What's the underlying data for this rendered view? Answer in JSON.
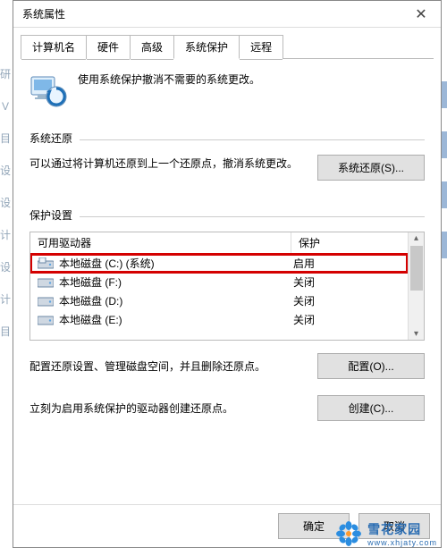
{
  "window": {
    "title": "系统属性",
    "close_glyph": "✕"
  },
  "tabs": [
    {
      "label": "计算机名"
    },
    {
      "label": "硬件"
    },
    {
      "label": "高级"
    },
    {
      "label": "系统保护",
      "active": true
    },
    {
      "label": "远程"
    }
  ],
  "intro": {
    "text": "使用系统保护撤消不需要的系统更改。"
  },
  "restore": {
    "section_label": "系统还原",
    "text": "可以通过将计算机还原到上一个还原点，撤消系统更改。",
    "button": "系统还原(S)..."
  },
  "protection": {
    "section_label": "保护设置",
    "columns": {
      "drive": "可用驱动器",
      "status": "保护"
    },
    "rows": [
      {
        "icon": "system",
        "name": "本地磁盘 (C:) (系统)",
        "status": "启用",
        "highlight": true
      },
      {
        "icon": "drive",
        "name": "本地磁盘 (F:)",
        "status": "关闭"
      },
      {
        "icon": "drive",
        "name": "本地磁盘 (D:)",
        "status": "关闭"
      },
      {
        "icon": "drive",
        "name": "本地磁盘 (E:)",
        "status": "关闭"
      }
    ],
    "configure_text": "配置还原设置、管理磁盘空间，并且删除还原点。",
    "configure_button": "配置(O)...",
    "create_text": "立刻为启用系统保护的驱动器创建还原点。",
    "create_button": "创建(C)..."
  },
  "footer": {
    "ok": "确定",
    "cancel": "取消"
  },
  "watermark": {
    "line1": "雪花家园",
    "line2": "www.xhjaty.com"
  },
  "scroll": {
    "up": "▴",
    "down": "▾"
  }
}
